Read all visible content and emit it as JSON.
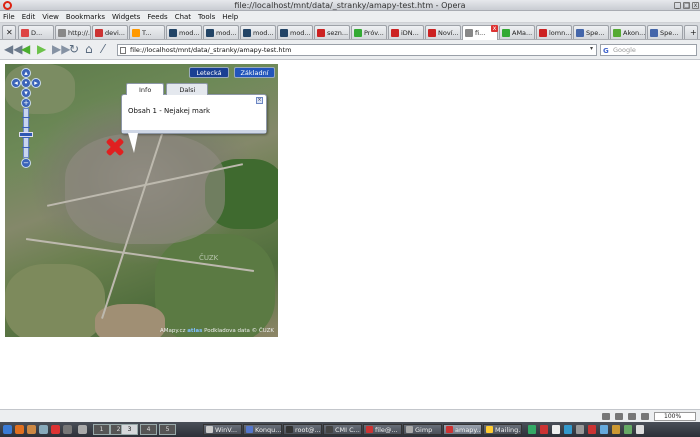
{
  "window": {
    "title": "file://localhost/mnt/data/_stranky/amapy-test.htm - Opera"
  },
  "menu": [
    "File",
    "Edit",
    "View",
    "Bookmarks",
    "Widgets",
    "Feeds",
    "Chat",
    "Tools",
    "Help"
  ],
  "tabs": [
    {
      "label": "D...",
      "icon_color": "#d44"
    },
    {
      "label": "http://...",
      "icon_color": "#888"
    },
    {
      "label": "devi...",
      "icon_color": "#c33"
    },
    {
      "label": "T...",
      "icon_color": "#f90"
    },
    {
      "label": "mod...",
      "icon_color": "#246"
    },
    {
      "label": "mod...",
      "icon_color": "#246"
    },
    {
      "label": "mod...",
      "icon_color": "#246"
    },
    {
      "label": "mod...",
      "icon_color": "#246"
    },
    {
      "label": "sezn...",
      "icon_color": "#c22"
    },
    {
      "label": "Próv...",
      "icon_color": "#3a3"
    },
    {
      "label": "iDN...",
      "icon_color": "#c22"
    },
    {
      "label": "Noví...",
      "icon_color": "#c22"
    },
    {
      "label": "fi...",
      "icon_color": "#888"
    },
    {
      "label": "AMa...",
      "icon_color": "#3a3"
    },
    {
      "label": "lomn...",
      "icon_color": "#c22"
    },
    {
      "label": "Spe...",
      "icon_color": "#46a"
    },
    {
      "label": "Akon...",
      "icon_color": "#5a3"
    },
    {
      "label": "Spe...",
      "icon_color": "#46a"
    }
  ],
  "address": {
    "url": "file://localhost/mnt/data/_stranky/amapy-test.htm",
    "search_placeholder": "Google"
  },
  "map": {
    "type_buttons": [
      "Letecká",
      "Základní"
    ],
    "active_type": 0,
    "zoom_level": 0.45,
    "bubble": {
      "tabs": [
        "Info",
        "Dalsi"
      ],
      "content": "Obsah 1 - Nejakej mark"
    },
    "copyright": {
      "prefix": "AMapy.cz",
      "logo": "atlas",
      "suffix": "Podkladova data © ČUZK"
    },
    "overlay_text": "ČUZK"
  },
  "status": {
    "zoom": "100%"
  },
  "taskbar": {
    "desktops": [
      "1",
      "2",
      "3",
      "4",
      "5"
    ],
    "active_desktop": 2,
    "tasks": [
      {
        "label": "WinV...",
        "icon_color": "#ccc"
      },
      {
        "label": "Konqu...",
        "icon_color": "#57c"
      },
      {
        "label": "root@...",
        "icon_color": "#333"
      },
      {
        "label": "CMI C...",
        "icon_color": "#444"
      },
      {
        "label": "file@...",
        "icon_color": "#c33"
      },
      {
        "label": "Gimp",
        "icon_color": "#aaa"
      },
      {
        "label": "amapy...",
        "icon_color": "#c33"
      },
      {
        "label": "Mailing...",
        "icon_color": "#fc3"
      }
    ]
  }
}
